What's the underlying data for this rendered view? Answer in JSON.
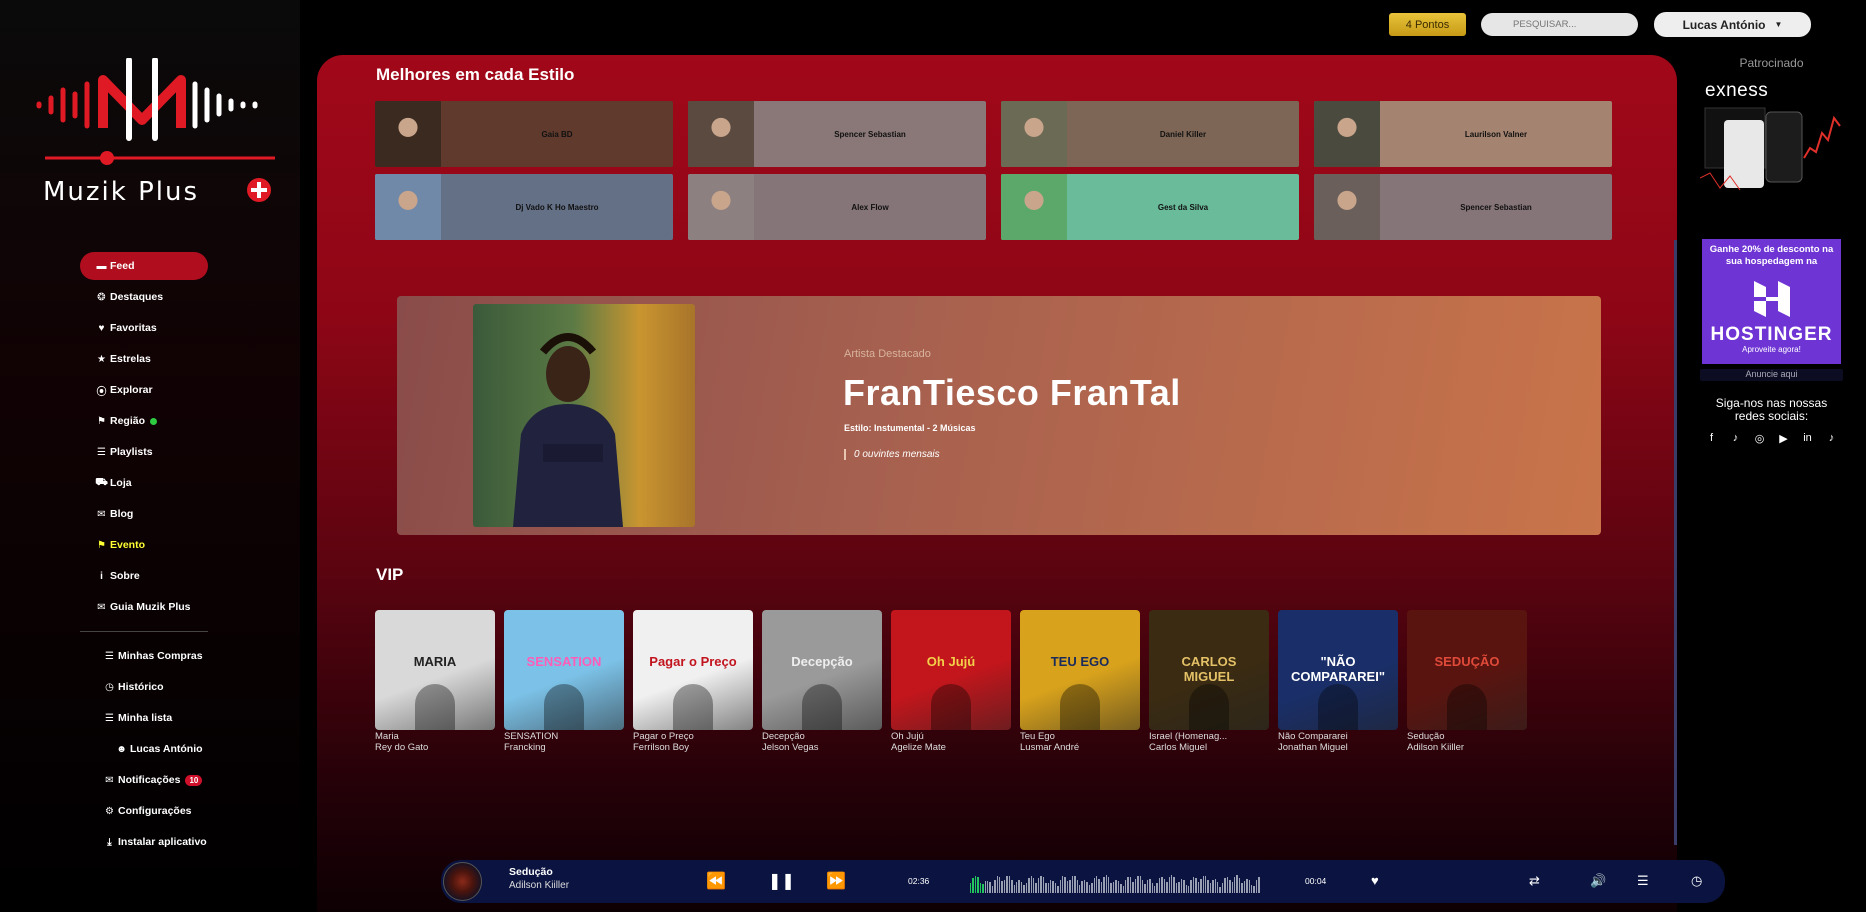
{
  "brand": {
    "name": "Muzik Plus"
  },
  "sidebar": {
    "items": [
      {
        "label": "Feed",
        "icon": "feed-icon",
        "glyph": "▬",
        "active": true
      },
      {
        "label": "Destaques",
        "icon": "lightbulb-icon",
        "glyph": "❂"
      },
      {
        "label": "Favoritas",
        "icon": "heart-icon",
        "glyph": "♥"
      },
      {
        "label": "Estrelas",
        "icon": "star-icon",
        "glyph": "★"
      },
      {
        "label": "Explorar",
        "icon": "compass-icon",
        "glyph": "⦿"
      },
      {
        "label": "Região",
        "icon": "flag-icon",
        "glyph": "⚑",
        "online_dot": true
      },
      {
        "label": "Playlists",
        "icon": "list-icon",
        "glyph": "☰"
      },
      {
        "label": "Loja",
        "icon": "cart-icon",
        "glyph": "⛟"
      },
      {
        "label": "Blog",
        "icon": "blog-icon",
        "glyph": "✉"
      },
      {
        "label": "Evento",
        "icon": "flag-icon",
        "glyph": "⚑",
        "highlight": "#ffff33"
      },
      {
        "label": "Sobre",
        "icon": "info-icon",
        "glyph": "i"
      },
      {
        "label": "Guia Muzik Plus",
        "icon": "guide-icon",
        "glyph": "✉"
      }
    ],
    "secondary": [
      {
        "label": "Minhas Compras",
        "icon": "list-icon",
        "glyph": "☰"
      },
      {
        "label": "Histórico",
        "icon": "clock-icon",
        "glyph": "◷"
      },
      {
        "label": "Minha lista",
        "icon": "list-icon",
        "glyph": "☰"
      },
      {
        "label": "Lucas António",
        "icon": "user-icon",
        "glyph": "☻"
      },
      {
        "label": "Notificações",
        "icon": "bell-icon",
        "glyph": "✉",
        "badge": "10"
      },
      {
        "label": "Configurações",
        "icon": "gear-icon",
        "glyph": "⚙"
      },
      {
        "label": "Instalar aplicativo",
        "icon": "download-icon",
        "glyph": "⤓"
      }
    ]
  },
  "topbar": {
    "points": "4 Pontos",
    "search_placeholder": "PESQUISAR...",
    "user_name": "Lucas António"
  },
  "best_by_style": {
    "title": "Melhores em cada Estilo",
    "cards": [
      {
        "name": "Gaia BD",
        "bg": "#5f3a2d",
        "thumb": "#3a2a20"
      },
      {
        "name": "Spencer Sebastian",
        "bg": "#8a7777",
        "thumb": "#5a4a40"
      },
      {
        "name": "Daniel Killer",
        "bg": "#7d6656",
        "thumb": "#6b6a55"
      },
      {
        "name": "Laurilson Valner",
        "bg": "#a48370",
        "thumb": "#4a4a3f"
      },
      {
        "name": "Dj Vado K Ho Maestro",
        "bg": "#647086",
        "thumb": "#7189a8"
      },
      {
        "name": "Alex Flow",
        "bg": "#857478",
        "thumb": "#8c8080"
      },
      {
        "name": "Gest da Silva",
        "bg": "#69bb9a",
        "thumb": "#5ba86a"
      },
      {
        "name": "Spencer Sebastian",
        "bg": "#857478",
        "thumb": "#6a5f5a"
      }
    ]
  },
  "featured": {
    "kicker": "Artista Destacado",
    "artist": "FranTiesco FranTal",
    "style": "Estilo: Instumental - 2 Músicas",
    "listeners": "0 ouvintes mensais"
  },
  "vip": {
    "title": "VIP",
    "items": [
      {
        "title": "Maria",
        "artist": "Rey do Gato",
        "cover_text": "MARIA",
        "bg": "#d9d9d9",
        "fg": "#222"
      },
      {
        "title": "SENSATION",
        "artist": "Francking",
        "cover_text": "SENSATION",
        "bg": "#7cc2e8",
        "fg": "#ff5db8"
      },
      {
        "title": "Pagar o Preço",
        "artist": "Ferrilson Boy",
        "cover_text": "Pagar o Preço",
        "bg": "#f0f0f0",
        "fg": "#c2141e"
      },
      {
        "title": "Decepção",
        "artist": "Jelson Vegas",
        "cover_text": "Decepção",
        "bg": "#9a9a9a",
        "fg": "#eee"
      },
      {
        "title": "Oh Jujú",
        "artist": "Agelize Mate",
        "cover_text": "Oh Jujú",
        "bg": "#c3161c",
        "fg": "#f3d04a"
      },
      {
        "title": "Teu Ego",
        "artist": "Lusmar André",
        "cover_text": "TEU EGO",
        "bg": "#d8a21c",
        "fg": "#1b2b5c"
      },
      {
        "title": "Israel (Homenag...",
        "artist": "Carlos Miguel",
        "cover_text": "CARLOS MIGUEL",
        "bg": "#3a2b12",
        "fg": "#e4c067"
      },
      {
        "title": "Não Compararei",
        "artist": "Jonathan Miguel",
        "cover_text": "\"NÃO COMPARAREI\"",
        "bg": "#1a2f6a",
        "fg": "#fff"
      },
      {
        "title": "Sedução",
        "artist": "Adilson Kiiller",
        "cover_text": "SEDUÇÃO",
        "bg": "#5a140f",
        "fg": "#e04a3a"
      }
    ]
  },
  "ads": {
    "sponsored": "Patrocinado",
    "exness": "exness",
    "hostinger_promo": "Ganhe 20% de desconto na sua hospedagem na",
    "hostinger": "HOSTINGER",
    "hostinger_cta": "Aproveite agora!",
    "ad_link": "Anuncie aqui",
    "social_title": "Siga-nos nas nossas redes sociais:",
    "social": [
      "facebook-icon",
      "tiktok-icon",
      "instagram-icon",
      "youtube-icon",
      "linkedin-icon",
      "tiktok-icon"
    ]
  },
  "player": {
    "track": "Sedução",
    "artist": "Adilson Kiiller",
    "elapsed": "02:36",
    "remaining": "00:04",
    "progress": 0.95
  }
}
